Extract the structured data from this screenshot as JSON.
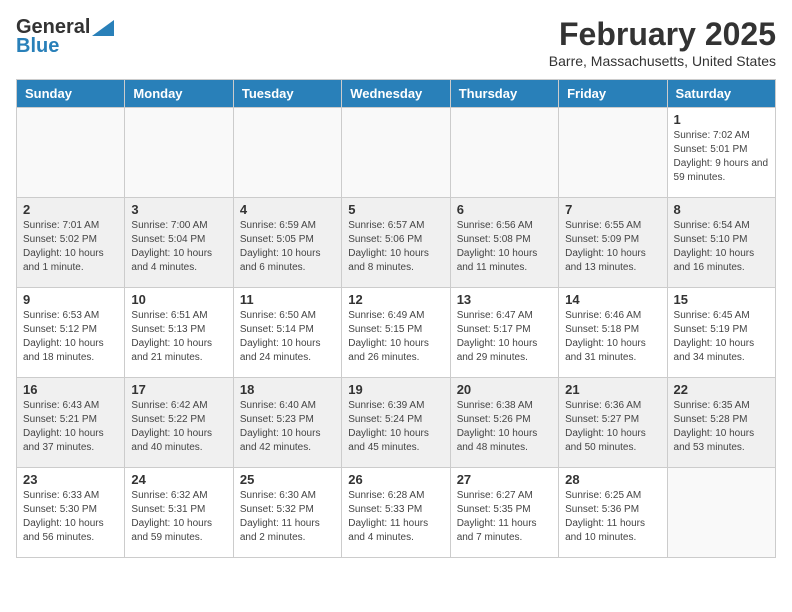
{
  "header": {
    "logo_general": "General",
    "logo_blue": "Blue",
    "month_title": "February 2025",
    "location": "Barre, Massachusetts, United States"
  },
  "weekdays": [
    "Sunday",
    "Monday",
    "Tuesday",
    "Wednesday",
    "Thursday",
    "Friday",
    "Saturday"
  ],
  "weeks": [
    [
      {
        "day": "",
        "info": ""
      },
      {
        "day": "",
        "info": ""
      },
      {
        "day": "",
        "info": ""
      },
      {
        "day": "",
        "info": ""
      },
      {
        "day": "",
        "info": ""
      },
      {
        "day": "",
        "info": ""
      },
      {
        "day": "1",
        "info": "Sunrise: 7:02 AM\nSunset: 5:01 PM\nDaylight: 9 hours and 59 minutes."
      }
    ],
    [
      {
        "day": "2",
        "info": "Sunrise: 7:01 AM\nSunset: 5:02 PM\nDaylight: 10 hours and 1 minute."
      },
      {
        "day": "3",
        "info": "Sunrise: 7:00 AM\nSunset: 5:04 PM\nDaylight: 10 hours and 4 minutes."
      },
      {
        "day": "4",
        "info": "Sunrise: 6:59 AM\nSunset: 5:05 PM\nDaylight: 10 hours and 6 minutes."
      },
      {
        "day": "5",
        "info": "Sunrise: 6:57 AM\nSunset: 5:06 PM\nDaylight: 10 hours and 8 minutes."
      },
      {
        "day": "6",
        "info": "Sunrise: 6:56 AM\nSunset: 5:08 PM\nDaylight: 10 hours and 11 minutes."
      },
      {
        "day": "7",
        "info": "Sunrise: 6:55 AM\nSunset: 5:09 PM\nDaylight: 10 hours and 13 minutes."
      },
      {
        "day": "8",
        "info": "Sunrise: 6:54 AM\nSunset: 5:10 PM\nDaylight: 10 hours and 16 minutes."
      }
    ],
    [
      {
        "day": "9",
        "info": "Sunrise: 6:53 AM\nSunset: 5:12 PM\nDaylight: 10 hours and 18 minutes."
      },
      {
        "day": "10",
        "info": "Sunrise: 6:51 AM\nSunset: 5:13 PM\nDaylight: 10 hours and 21 minutes."
      },
      {
        "day": "11",
        "info": "Sunrise: 6:50 AM\nSunset: 5:14 PM\nDaylight: 10 hours and 24 minutes."
      },
      {
        "day": "12",
        "info": "Sunrise: 6:49 AM\nSunset: 5:15 PM\nDaylight: 10 hours and 26 minutes."
      },
      {
        "day": "13",
        "info": "Sunrise: 6:47 AM\nSunset: 5:17 PM\nDaylight: 10 hours and 29 minutes."
      },
      {
        "day": "14",
        "info": "Sunrise: 6:46 AM\nSunset: 5:18 PM\nDaylight: 10 hours and 31 minutes."
      },
      {
        "day": "15",
        "info": "Sunrise: 6:45 AM\nSunset: 5:19 PM\nDaylight: 10 hours and 34 minutes."
      }
    ],
    [
      {
        "day": "16",
        "info": "Sunrise: 6:43 AM\nSunset: 5:21 PM\nDaylight: 10 hours and 37 minutes."
      },
      {
        "day": "17",
        "info": "Sunrise: 6:42 AM\nSunset: 5:22 PM\nDaylight: 10 hours and 40 minutes."
      },
      {
        "day": "18",
        "info": "Sunrise: 6:40 AM\nSunset: 5:23 PM\nDaylight: 10 hours and 42 minutes."
      },
      {
        "day": "19",
        "info": "Sunrise: 6:39 AM\nSunset: 5:24 PM\nDaylight: 10 hours and 45 minutes."
      },
      {
        "day": "20",
        "info": "Sunrise: 6:38 AM\nSunset: 5:26 PM\nDaylight: 10 hours and 48 minutes."
      },
      {
        "day": "21",
        "info": "Sunrise: 6:36 AM\nSunset: 5:27 PM\nDaylight: 10 hours and 50 minutes."
      },
      {
        "day": "22",
        "info": "Sunrise: 6:35 AM\nSunset: 5:28 PM\nDaylight: 10 hours and 53 minutes."
      }
    ],
    [
      {
        "day": "23",
        "info": "Sunrise: 6:33 AM\nSunset: 5:30 PM\nDaylight: 10 hours and 56 minutes."
      },
      {
        "day": "24",
        "info": "Sunrise: 6:32 AM\nSunset: 5:31 PM\nDaylight: 10 hours and 59 minutes."
      },
      {
        "day": "25",
        "info": "Sunrise: 6:30 AM\nSunset: 5:32 PM\nDaylight: 11 hours and 2 minutes."
      },
      {
        "day": "26",
        "info": "Sunrise: 6:28 AM\nSunset: 5:33 PM\nDaylight: 11 hours and 4 minutes."
      },
      {
        "day": "27",
        "info": "Sunrise: 6:27 AM\nSunset: 5:35 PM\nDaylight: 11 hours and 7 minutes."
      },
      {
        "day": "28",
        "info": "Sunrise: 6:25 AM\nSunset: 5:36 PM\nDaylight: 11 hours and 10 minutes."
      },
      {
        "day": "",
        "info": ""
      }
    ]
  ]
}
